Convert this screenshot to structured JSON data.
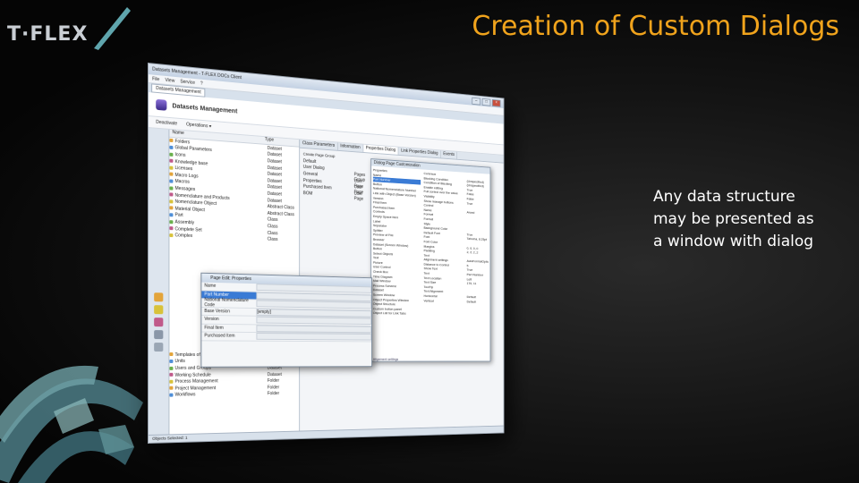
{
  "slide": {
    "title": "Creation of Custom Dialogs",
    "caption": "Any data structure\nmay be presented as\na window with dialog",
    "logo_text": "T·FLEX",
    "accent_color": "#f0a31c"
  },
  "window": {
    "title": "Datasets Management - T-FLEX DOCs Client",
    "menu": [
      "File",
      "View",
      "Service",
      "?"
    ],
    "tab": "Datasets Management",
    "header_title": "Datasets Management",
    "toolbar": {
      "deactivate": "Deactivate",
      "operations": "Operations ▾"
    },
    "tree_columns": {
      "name": "Name",
      "type": "Type"
    },
    "tree_rows": [
      {
        "name": "Folders",
        "type": "Dataset"
      },
      {
        "name": "Global Parameters",
        "type": "Dataset"
      },
      {
        "name": "Icons",
        "type": "Dataset"
      },
      {
        "name": "Knowledge base",
        "type": "Dataset"
      },
      {
        "name": "Licenses",
        "type": "Dataset"
      },
      {
        "name": "Macro Logs",
        "type": "Dataset"
      },
      {
        "name": "Macros",
        "type": "Dataset"
      },
      {
        "name": "Messages",
        "type": "Dataset"
      },
      {
        "name": "Nomenclature and Products",
        "type": "Dataset"
      },
      {
        "name": "Nomenclature Object",
        "type": "Abstract Class"
      },
      {
        "name": "Material Object",
        "type": "Abstract Class"
      },
      {
        "name": "Part",
        "type": "Class"
      },
      {
        "name": "Assembly",
        "type": "Class"
      },
      {
        "name": "Complete Set",
        "type": "Class"
      },
      {
        "name": "Complex",
        "type": "Class"
      }
    ],
    "tree_rows_bottom": [
      {
        "name": "Templates of version names",
        "type": "Dataset"
      },
      {
        "name": "Units",
        "type": "Dataset"
      },
      {
        "name": "Users and Groups",
        "type": "Dataset"
      },
      {
        "name": "Working Schedule",
        "type": "Dataset"
      },
      {
        "name": "Process Management",
        "type": "Folder"
      },
      {
        "name": "Project Management",
        "type": "Folder"
      },
      {
        "name": "Workflows",
        "type": "Folder"
      }
    ],
    "right_tabs": [
      "Class Parameters",
      "Information",
      "Properties Dialog",
      "Link Properties Dialog",
      "Events"
    ],
    "right_list": [
      {
        "name": "Default",
        "type": ""
      },
      {
        "name": "User Dialog",
        "type": ""
      },
      {
        "name": "General",
        "type": "Pages Group"
      },
      {
        "name": "Properties",
        "type": "User Page"
      },
      {
        "name": "Purchased Item",
        "type": "User Page"
      },
      {
        "name": "BOM",
        "type": "User Page"
      }
    ],
    "right_toolbar": "Create Page Group",
    "custom_dialog": {
      "title": "Dialog Page Customization",
      "controls": [
        "Properties",
        "Name",
        "Part Number",
        "Button",
        "National Nomenclature Number",
        "Link with Object (Base Version)",
        "Version",
        "Final Item",
        "Purchased Item",
        "Controls",
        "Empty Space Item",
        "Label",
        "Separator",
        "Splitter",
        "Preview of File",
        "Browser",
        "Dataset (Screen Window)",
        "Button",
        "Select Objects",
        "Text",
        "Picture",
        "User Control",
        "Check Box",
        "Time Diagram",
        "Mail Window",
        "Process Scheme",
        "Dataset",
        "Screen Window",
        "Object Properties Window",
        "Object Structure",
        "Custom button panel",
        "Object List for Link Tabs"
      ],
      "props": [
        {
          "k": "Common",
          "v": ""
        },
        {
          "k": "Blocking Condition",
          "v": "(Unspecified)"
        },
        {
          "k": "Condition of Blocking",
          "v": "(Unspecified)"
        },
        {
          "k": "Enable editing",
          "v": "True"
        },
        {
          "k": "Full control over the value",
          "v": "False"
        },
        {
          "k": "Visibility",
          "v": "False"
        },
        {
          "k": "Show manage buttons",
          "v": "True"
        },
        {
          "k": "Control",
          "v": ""
        },
        {
          "k": "Name",
          "v": "Arand"
        },
        {
          "k": "Format",
          "v": ""
        },
        {
          "k": "Format",
          "v": ""
        },
        {
          "k": "Style",
          "v": ""
        },
        {
          "k": "Background Color",
          "v": ""
        },
        {
          "k": "Default Font",
          "v": "True"
        },
        {
          "k": "Font",
          "v": "Tahoma, 8.25pt"
        },
        {
          "k": "Font Color",
          "v": ""
        },
        {
          "k": "Margins",
          "v": "0, 0, 0, 0"
        },
        {
          "k": "Padding",
          "v": "2, 2, 2, 2"
        },
        {
          "k": "Text",
          "v": ""
        },
        {
          "k": "Alignment settings",
          "v": "AutoFormatOptions"
        },
        {
          "k": "Distance to Control",
          "v": "5"
        },
        {
          "k": "Show Text",
          "v": "True"
        },
        {
          "k": "Text",
          "v": "Part Number"
        },
        {
          "k": "Text Location",
          "v": "Left"
        },
        {
          "k": "Text Size",
          "v": "170, 11"
        },
        {
          "k": "ToolTip",
          "v": ""
        },
        {
          "k": "Text Alignment",
          "v": ""
        },
        {
          "k": "Horizontal",
          "v": "Default"
        },
        {
          "k": "Vertical",
          "v": "Default"
        }
      ],
      "status": "Alignment settings"
    },
    "page_edit": {
      "title": "Page Edit: Properties",
      "rows": [
        {
          "k": "Name",
          "v": ""
        },
        {
          "k": "Part Number",
          "v": ""
        },
        {
          "k": "National Nomenclature Code",
          "v": ""
        },
        {
          "k": "Base Version",
          "v": "[empty]"
        },
        {
          "k": "Version",
          "v": ""
        },
        {
          "k": "Final Item",
          "v": ""
        },
        {
          "k": "Purchased Item",
          "v": ""
        }
      ]
    },
    "statusbar": "Objects Selected: 1"
  }
}
